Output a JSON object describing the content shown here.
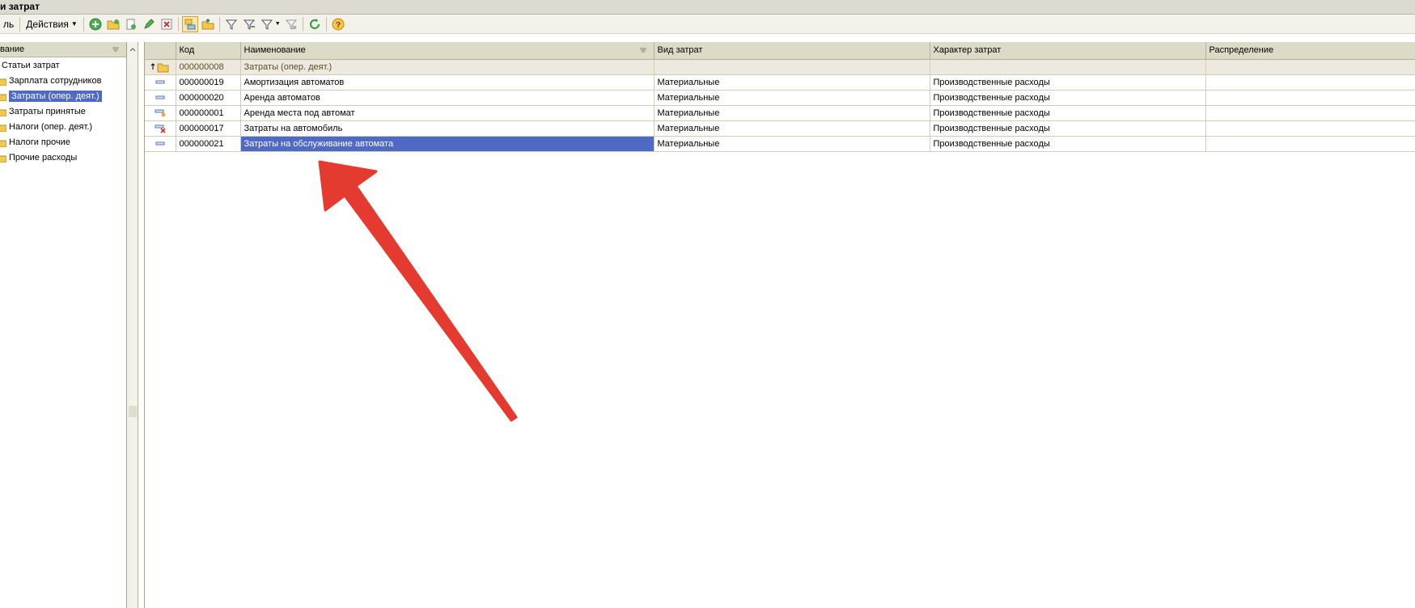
{
  "window": {
    "title": "и затрат"
  },
  "toolbar": {
    "left_label": "ль",
    "actions_label": "Действия"
  },
  "tree": {
    "header": "вание",
    "root_label": "Статьи затрат",
    "items": [
      {
        "label": "Зарплата сотрудников",
        "selected": false
      },
      {
        "label": "Затраты (опер. деят.)",
        "selected": true
      },
      {
        "label": "Затраты принятые",
        "selected": false
      },
      {
        "label": "Налоги (опер. деят.)",
        "selected": false
      },
      {
        "label": "Налоги прочие",
        "selected": false
      },
      {
        "label": "Прочие расходы",
        "selected": false
      }
    ]
  },
  "grid": {
    "columns": [
      "Код",
      "Наименование",
      "Вид затрат",
      "Характер затрат",
      "Распределение"
    ],
    "group_row": {
      "code": "000000008",
      "name": "Затраты (опер. деят.)"
    },
    "rows": [
      {
        "icon": "item-icon",
        "code": "000000019",
        "name": "Амортизация автоматов",
        "kind": "Материальные",
        "nature": "Производственные расходы",
        "distribution": ""
      },
      {
        "icon": "item-icon",
        "code": "000000020",
        "name": "Аренда автоматов",
        "kind": "Материальные",
        "nature": "Производственные расходы",
        "distribution": ""
      },
      {
        "icon": "item-edited-icon",
        "code": "000000001",
        "name": "Аренда места под автомат",
        "kind": "Материальные",
        "nature": "Производственные расходы",
        "distribution": ""
      },
      {
        "icon": "item-deleted-icon",
        "code": "000000017",
        "name": "Затраты на автомобиль",
        "kind": "Материальные",
        "nature": "Производственные расходы",
        "distribution": ""
      },
      {
        "icon": "item-icon",
        "code": "000000021",
        "name": "Затраты на обслуживание автомата",
        "kind": "Материальные",
        "nature": "Производственные расходы",
        "distribution": ""
      }
    ]
  },
  "colors": {
    "selection": "#4f69c6",
    "header_bg": "#dcdbc8",
    "annotation_arrow": "#e53a2f"
  }
}
